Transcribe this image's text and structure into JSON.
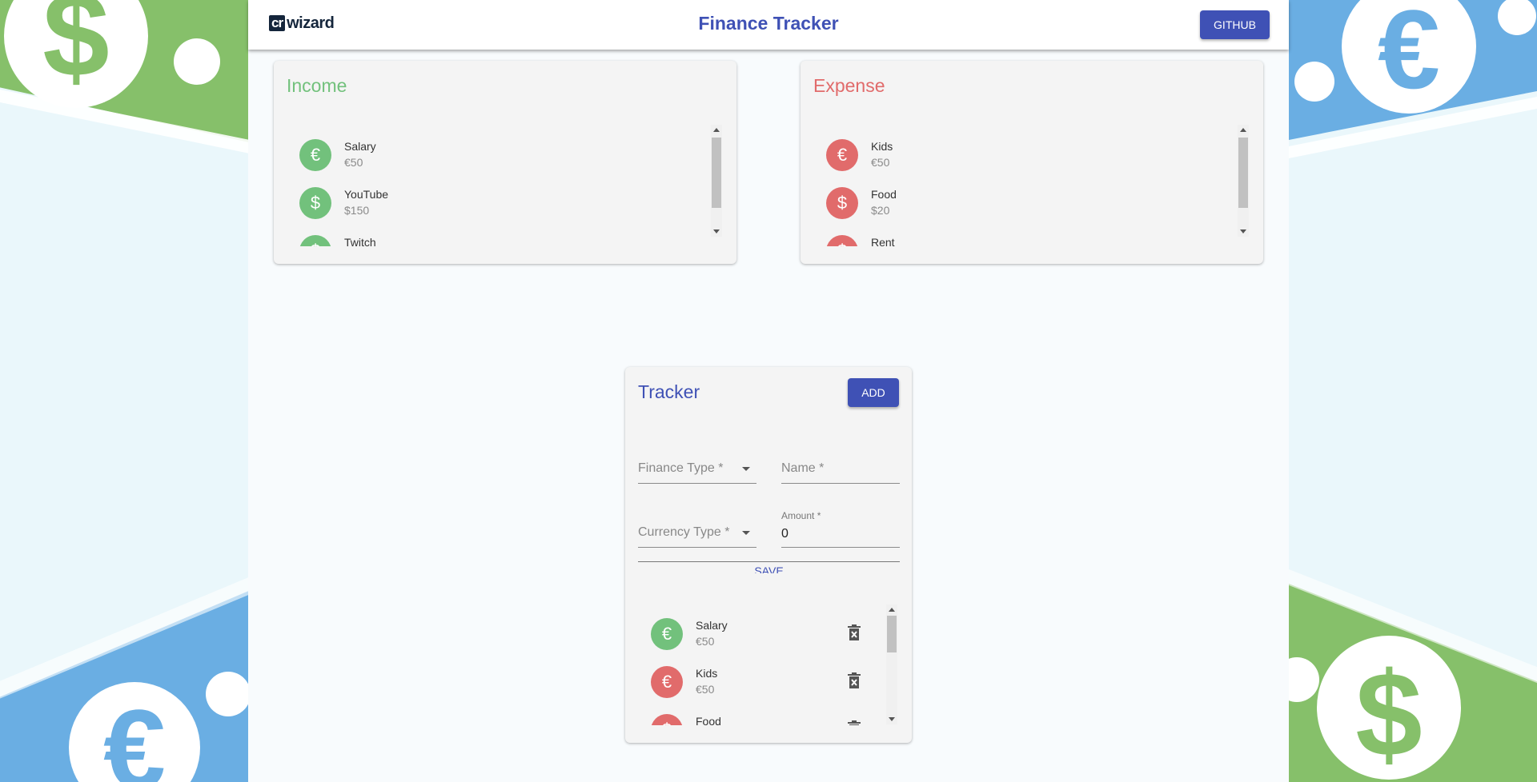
{
  "colors": {
    "primary": "#3f51b5",
    "income": "#72c17c",
    "expense": "#e16b6b",
    "bill_green": "#86c06a",
    "bill_blue": "#6aaee3"
  },
  "header": {
    "logo_box": "cr",
    "logo_word": "wizard",
    "title": "Finance Tracker",
    "github_label": "GITHUB"
  },
  "income": {
    "title": "Income",
    "items": [
      {
        "name": "Salary",
        "amount": "€50",
        "icon": "euro-icon",
        "symbol": "€"
      },
      {
        "name": "YouTube",
        "amount": "$150",
        "icon": "dollar-icon",
        "symbol": "$"
      },
      {
        "name": "Twitch",
        "amount": "",
        "icon": "dollar-icon",
        "symbol": "$"
      }
    ]
  },
  "expense": {
    "title": "Expense",
    "items": [
      {
        "name": "Kids",
        "amount": "€50",
        "icon": "euro-icon",
        "symbol": "€"
      },
      {
        "name": "Food",
        "amount": "$20",
        "icon": "dollar-icon",
        "symbol": "$"
      },
      {
        "name": "Rent",
        "amount": "",
        "icon": "dollar-icon",
        "symbol": "$"
      }
    ]
  },
  "tracker": {
    "title": "Tracker",
    "add_label": "ADD",
    "finance_type_label": "Finance Type *",
    "name_label": "Name *",
    "currency_type_label": "Currency Type *",
    "amount_label": "Amount *",
    "amount_value": "0",
    "save_label": "SAVE",
    "items": [
      {
        "name": "Salary",
        "amount": "€50",
        "type": "income",
        "symbol": "€"
      },
      {
        "name": "Kids",
        "amount": "€50",
        "type": "expense",
        "symbol": "€"
      },
      {
        "name": "Food",
        "amount": "",
        "type": "expense",
        "symbol": "$"
      }
    ]
  }
}
